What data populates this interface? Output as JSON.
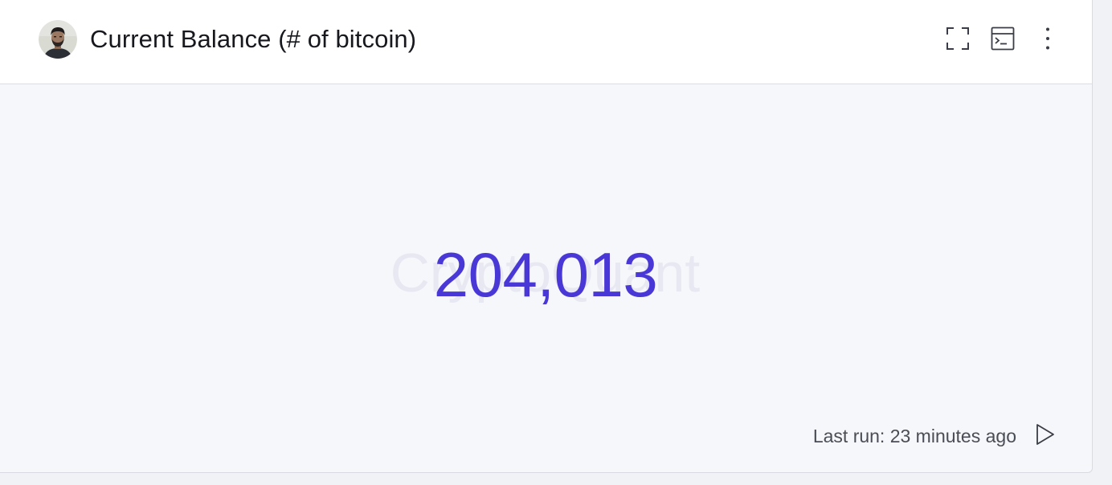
{
  "card": {
    "title": "Current Balance (# of bitcoin)",
    "avatar_icon": "user-avatar",
    "actions": {
      "fullscreen_icon": "fullscreen-icon",
      "query_icon": "terminal-icon",
      "more_icon": "more-vertical-icon"
    }
  },
  "metric": {
    "value": "204,013",
    "watermark": "CryptoQuant",
    "value_color": "#4a38d6"
  },
  "footer": {
    "last_run": "Last run: 23 minutes ago",
    "run_icon": "play-icon"
  }
}
